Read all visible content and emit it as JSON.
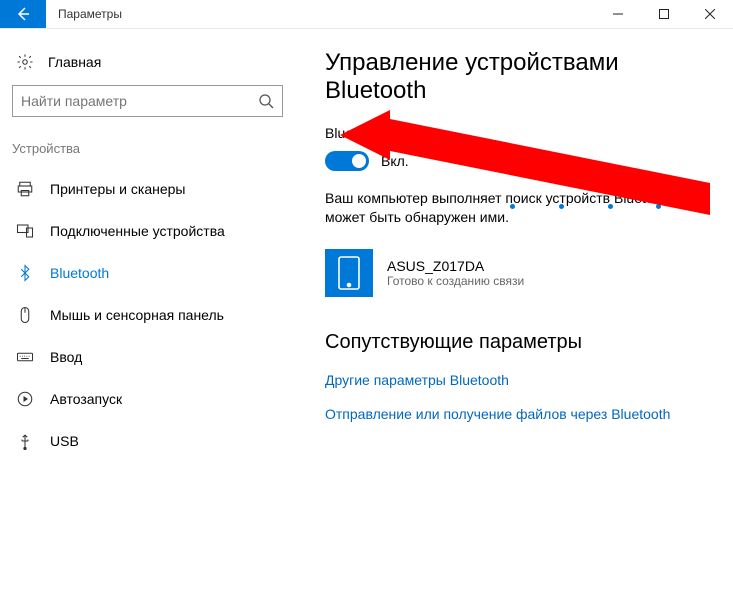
{
  "window": {
    "title": "Параметры"
  },
  "sidebar": {
    "home": "Главная",
    "search_placeholder": "Найти параметр",
    "category": "Устройства",
    "items": [
      {
        "label": "Принтеры и сканеры"
      },
      {
        "label": "Подключенные устройства"
      },
      {
        "label": "Bluetooth"
      },
      {
        "label": "Мышь и сенсорная панель"
      },
      {
        "label": "Ввод"
      },
      {
        "label": "Автозапуск"
      },
      {
        "label": "USB"
      }
    ]
  },
  "main": {
    "title": "Управление устройствами Bluetooth",
    "toggle_section": "Bluetooth",
    "toggle_state": "Вкл.",
    "description": "Ваш компьютер выполняет поиск устройств Bluetooth и может быть обнаружен ими.",
    "device": {
      "name": "ASUS_Z017DA",
      "status": "Готово к созданию связи"
    },
    "related_title": "Сопутствующие параметры",
    "links": [
      "Другие параметры Bluetooth",
      "Отправление или получение файлов через Bluetooth"
    ]
  }
}
